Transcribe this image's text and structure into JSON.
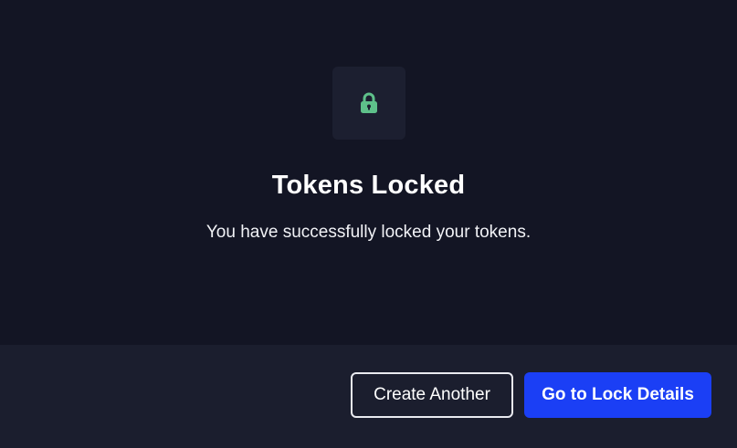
{
  "modal": {
    "icon": "lock-icon",
    "icon_color": "#5ec08a",
    "title": "Tokens Locked",
    "message": "You have successfully locked your tokens."
  },
  "footer": {
    "secondary_label": "Create Another",
    "primary_label": "Go to Lock Details",
    "primary_color": "#1b3ff5"
  }
}
